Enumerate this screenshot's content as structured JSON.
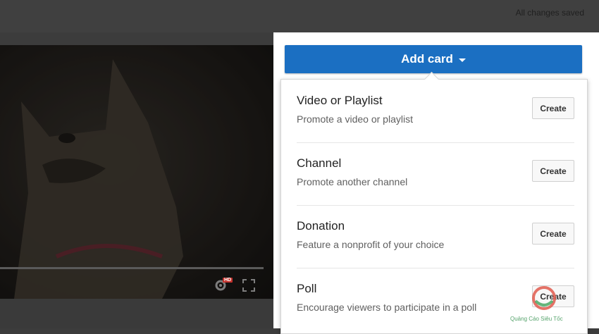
{
  "header": {
    "status_text": "All changes saved"
  },
  "panel": {
    "add_card_label": "Add card",
    "items": [
      {
        "title": "Video or Playlist",
        "description": "Promote a video or playlist",
        "button": "Create"
      },
      {
        "title": "Channel",
        "description": "Promote another channel",
        "button": "Create"
      },
      {
        "title": "Donation",
        "description": "Feature a nonprofit of your choice",
        "button": "Create"
      },
      {
        "title": "Poll",
        "description": "Encourage viewers to participate in a poll",
        "button": "Create"
      }
    ]
  },
  "video": {
    "controls": [
      "settings-icon",
      "fullscreen-icon"
    ],
    "hd_badge": "HD"
  },
  "watermark": {
    "text": "Quảng Cáo Siêu Tốc"
  },
  "colors": {
    "accent": "#1b6fc2",
    "background": "#3c3c3c",
    "panel": "#ffffff"
  }
}
